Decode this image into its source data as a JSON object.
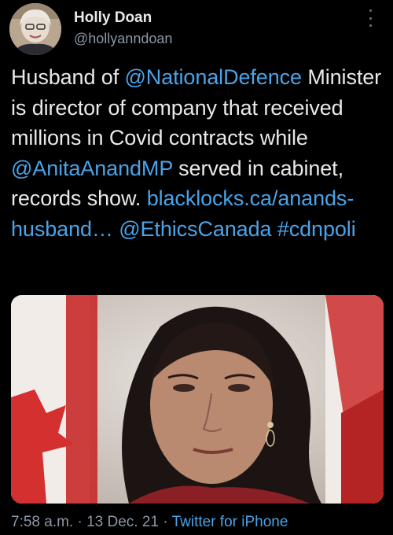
{
  "author": {
    "name": "Holly Doan",
    "handle": "@hollyanndoan"
  },
  "tweet": {
    "segments": [
      {
        "text": "Husband of ",
        "link": false
      },
      {
        "text": "@NationalDefence",
        "link": true
      },
      {
        "text": " Minister is director of company that received millions in Covid contracts while ",
        "link": false
      },
      {
        "text": "@AnitaAnandMP",
        "link": true
      },
      {
        "text": " served in cabinet, records show. ",
        "link": false
      },
      {
        "text": "blacklocks.ca/anands-husband…",
        "link": true
      },
      {
        "text": " ",
        "link": false
      },
      {
        "text": "@EthicsCanada",
        "link": true
      },
      {
        "text": " ",
        "link": false
      },
      {
        "text": "#cdnpoli",
        "link": true
      }
    ]
  },
  "footer": {
    "time": "7:58 a.m.",
    "separator": "·",
    "date": "13 Dec. 21",
    "source": "Twitter for iPhone"
  },
  "colors": {
    "background": "#000000",
    "text": "#e7e9ea",
    "link": "#4aa3e8",
    "muted": "#8b98a5"
  },
  "icons": {
    "more": "more-vertical-icon"
  }
}
